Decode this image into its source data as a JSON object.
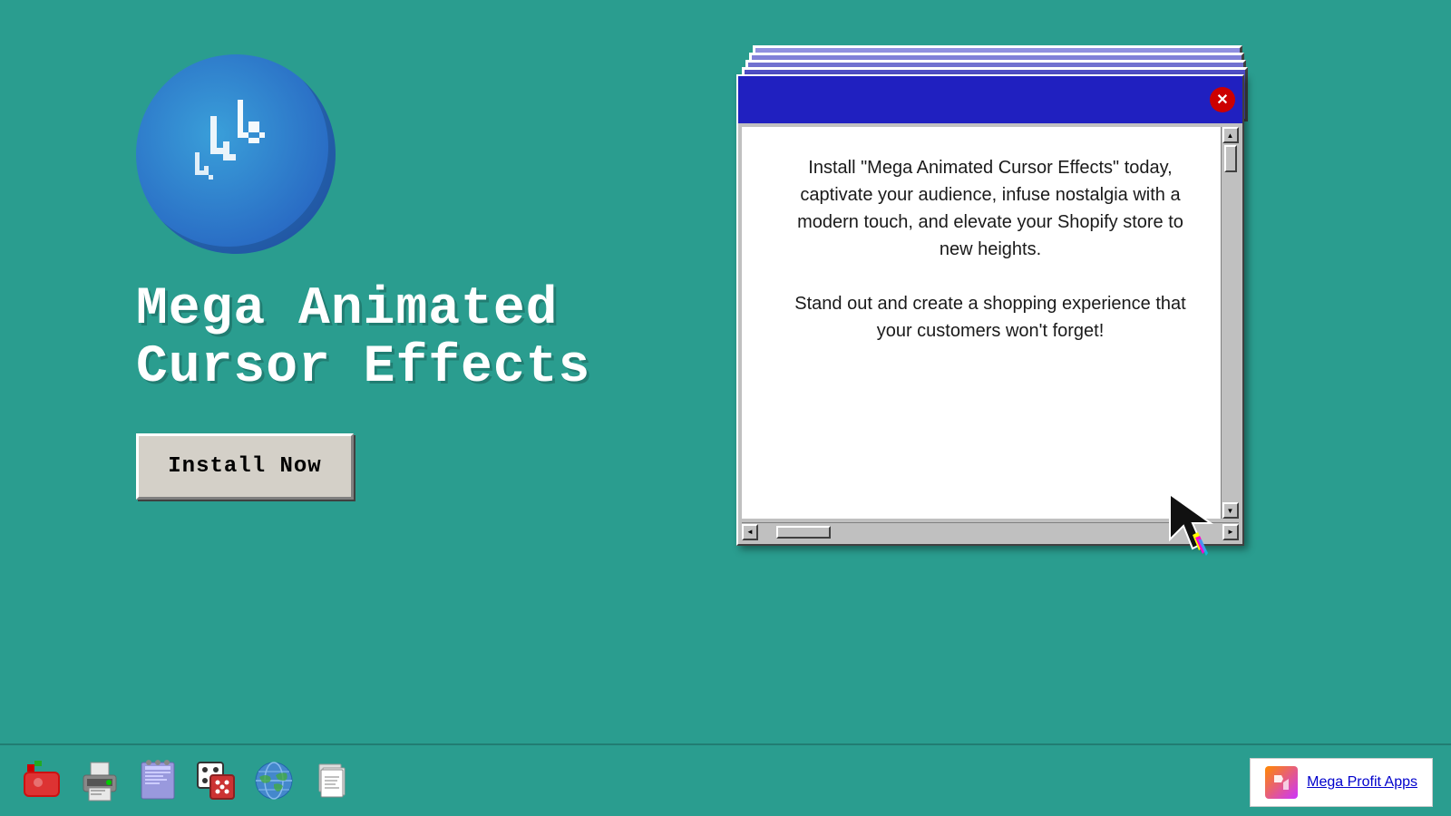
{
  "background_color": "#2a9d8f",
  "left": {
    "title_line1": "Mega Animated",
    "title_line2": "Cursor Effects",
    "install_button_label": "Install Now"
  },
  "window": {
    "titlebar_color": "#2020c0",
    "close_label": "✕",
    "paragraph1": "Install \"Mega Animated Cursor Effects\" today, captivate your audience, infuse nostalgia with a modern touch, and elevate your Shopify store to new heights.",
    "paragraph2": "Stand out and create a shopping experience that your customers won't forget!"
  },
  "taskbar": {
    "icons": [
      {
        "name": "apple-icon",
        "label": "Apple"
      },
      {
        "name": "printer-icon",
        "label": "Printer"
      },
      {
        "name": "notepad-icon",
        "label": "Notepad"
      },
      {
        "name": "dice-icon",
        "label": "Dice"
      },
      {
        "name": "globe-icon",
        "label": "Globe"
      },
      {
        "name": "documents-icon",
        "label": "Documents"
      }
    ]
  },
  "profit_apps": {
    "badge_label": "Mega Profit Apps",
    "link_text": "Mega Profit Apps"
  }
}
